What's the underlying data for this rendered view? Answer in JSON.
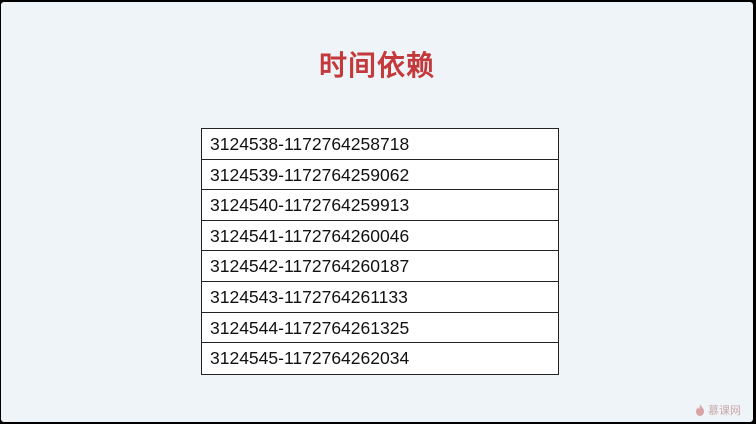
{
  "slide": {
    "title": "时间依赖",
    "rows": [
      "3124538-1172764258718",
      "3124539-1172764259062",
      "3124540-1172764259913",
      "3124541-1172764260046",
      "3124542-1172764260187",
      "3124543-1172764261133",
      "3124544-1172764261325",
      "3124545-1172764262034"
    ]
  },
  "watermark": {
    "text": "慕课网",
    "icon": "flame-logo-icon"
  },
  "colors": {
    "title": "#c4393b",
    "slide_background": "#eef4f8",
    "frame": "#000000"
  }
}
